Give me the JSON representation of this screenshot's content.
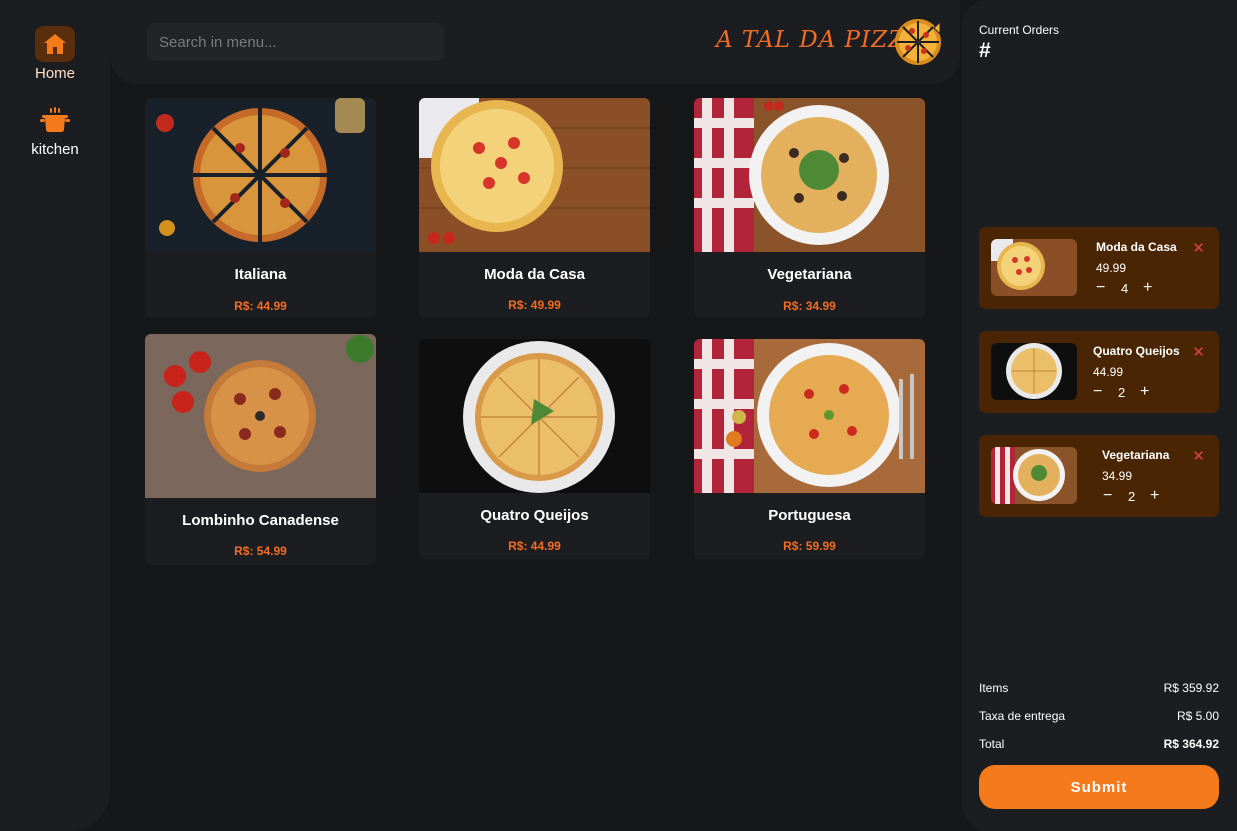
{
  "nav": {
    "home_label": "Home",
    "kitchen_label": "kitchen"
  },
  "header": {
    "search_placeholder": "Search in menu...",
    "brand": "A TAL DA PIZZA"
  },
  "menu": {
    "items": [
      {
        "name": "Italiana",
        "price": "R$: 44.99"
      },
      {
        "name": "Moda da Casa",
        "price": "R$: 49.99"
      },
      {
        "name": "Vegetariana",
        "price": "R$: 34.99"
      },
      {
        "name": "Lombinho Canadense",
        "price": "R$: 54.99"
      },
      {
        "name": "Quatro Queijos",
        "price": "R$: 44.99"
      },
      {
        "name": "Portuguesa",
        "price": "R$: 59.99"
      }
    ]
  },
  "orders": {
    "title": "Current Orders",
    "number": "#",
    "items": [
      {
        "name": "Moda da Casa",
        "price": "49.99",
        "qty": "4"
      },
      {
        "name": "Quatro Queijos",
        "price": "44.99",
        "qty": "2"
      },
      {
        "name": "Vegetariana",
        "price": "34.99",
        "qty": "2"
      }
    ],
    "minus": "−",
    "plus": "+",
    "remove": "✕"
  },
  "summary": {
    "items_label": "Items",
    "items_value": "R$ 359.92",
    "delivery_label": "Taxa de entrega",
    "delivery_value": "R$ 5.00",
    "total_label": "Total",
    "total_value": "R$ 364.92",
    "submit_label": "Submit"
  },
  "colors": {
    "accent": "#f36c24",
    "order_card": "#4a2503",
    "background": "#161719",
    "panel": "#1c1d20"
  }
}
